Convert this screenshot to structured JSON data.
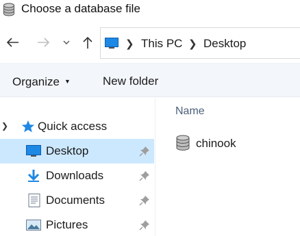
{
  "window": {
    "title": "Choose a database file"
  },
  "navigation": {
    "back": "arrow-left-icon",
    "forward": "arrow-right-icon",
    "recent": "chevron-down-icon",
    "up": "arrow-up-icon",
    "breadcrumb": [
      "This PC",
      "Desktop"
    ]
  },
  "toolbar": {
    "organize_label": "Organize",
    "new_folder_label": "New folder"
  },
  "sidebar": {
    "quick_access_label": "Quick access",
    "items": [
      {
        "label": "Desktop",
        "icon": "desktop-icon",
        "selected": true
      },
      {
        "label": "Downloads",
        "icon": "download-icon",
        "selected": false
      },
      {
        "label": "Documents",
        "icon": "documents-icon",
        "selected": false
      },
      {
        "label": "Pictures",
        "icon": "pictures-icon",
        "selected": false
      }
    ]
  },
  "file_list": {
    "column_name": "Name",
    "files": [
      {
        "name": "chinook",
        "icon": "database-icon"
      }
    ]
  },
  "colors": {
    "selection": "#cce8ff",
    "toolbar_bg": "#f3f6fb",
    "header_text": "#4c607a",
    "accent_blue": "#1e88e5"
  }
}
